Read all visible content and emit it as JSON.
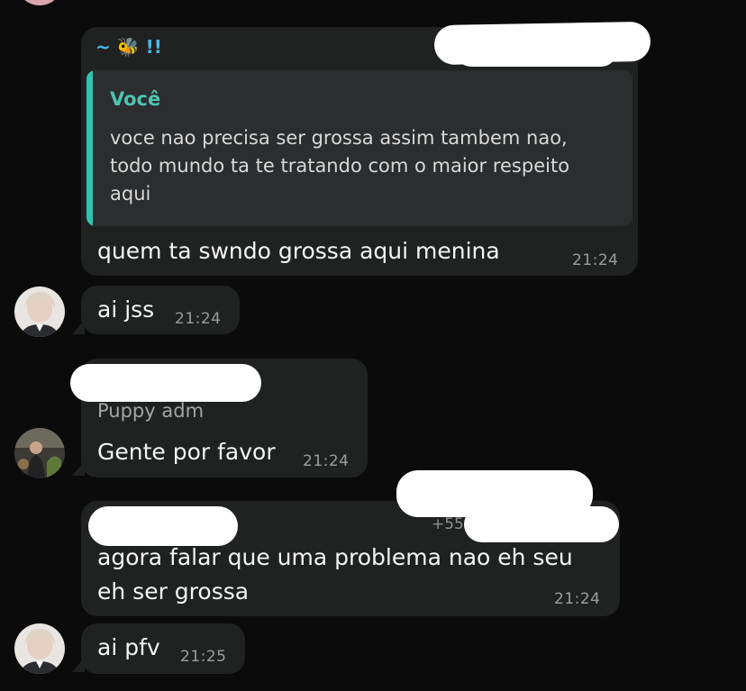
{
  "messages": [
    {
      "sender": "~ 🐝 !!",
      "quote": {
        "author": "Você",
        "text_lines": [
          "voce nao precisa ser grossa assim tambem nao,",
          "todo mundo ta te tratando com o maior respeito",
          "aqui"
        ]
      },
      "text": "quem ta swndo grossa aqui menina",
      "time": "21:24"
    },
    {
      "text": "ai jss",
      "time": "21:24"
    },
    {
      "sender": "Puppy adm",
      "text": "Gente por favor",
      "time": "21:24"
    },
    {
      "phone": "+55",
      "text_lines": [
        "agora falar que uma problema nao eh seu",
        "eh ser grossa"
      ],
      "time": "21:24"
    },
    {
      "text": "ai pfv",
      "time": "21:25"
    }
  ],
  "colors": {
    "background": "#0b0b0b",
    "bubble": "#202222",
    "quote_bar": "#33c2b1",
    "quote_author": "#4fc3b0",
    "sender": "#47b8ec",
    "timestamp": "#9a9d9f"
  }
}
